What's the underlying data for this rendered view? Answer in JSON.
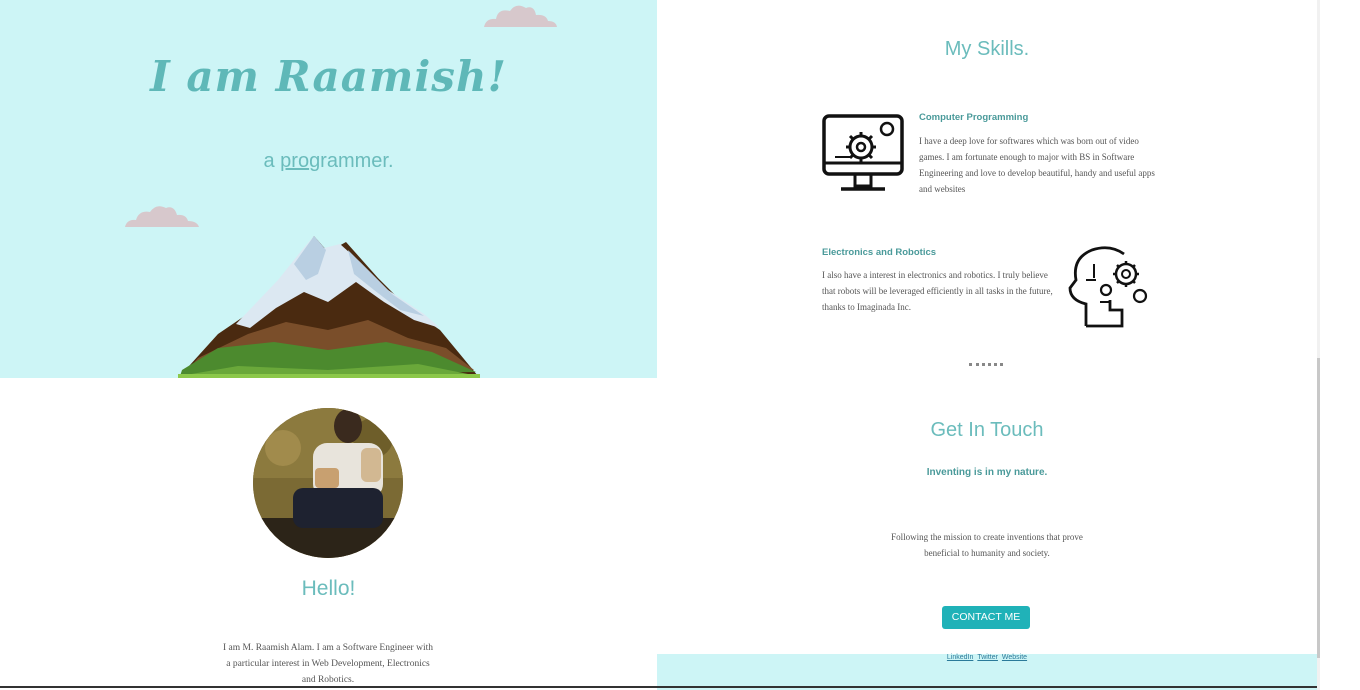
{
  "hero": {
    "title": "I am Raamish!",
    "subtitle_prefix": "a ",
    "subtitle_typed": "pro",
    "subtitle_rest": "grammer."
  },
  "about": {
    "greeting": "Hello!",
    "bio": "I am M. Raamish Alam. I am a Software Engineer with a particular interest in Web Development, Electronics and Robotics."
  },
  "skills": {
    "heading": "My Skills.",
    "items": [
      {
        "title": "Computer Programming",
        "text": "I have a deep love for softwares which was born out of video games. I am fortunate enough to major with BS in Software Engineering and love to develop beautiful, handy and useful apps and websites",
        "icon": "computer-gear-icon"
      },
      {
        "title": "Electronics and Robotics",
        "text": "I also have a interest in electronics and robotics. I truly believe that robots will be leveraged efficiently in all tasks in the future, thanks to Imaginada Inc.",
        "icon": "head-gears-icon"
      }
    ]
  },
  "contact": {
    "heading": "Get In Touch",
    "tagline": "Inventing is in my nature.",
    "mission": "Following the mission to create inventions that prove beneficial to humanity and society.",
    "button_label": "CONTACT ME"
  },
  "footer": {
    "links": [
      "LinkedIn",
      "Twitter",
      "Website"
    ]
  },
  "colors": {
    "hero_bg": "#cdf5f6",
    "accent": "#6bbcbc",
    "button": "#20b2b8"
  }
}
